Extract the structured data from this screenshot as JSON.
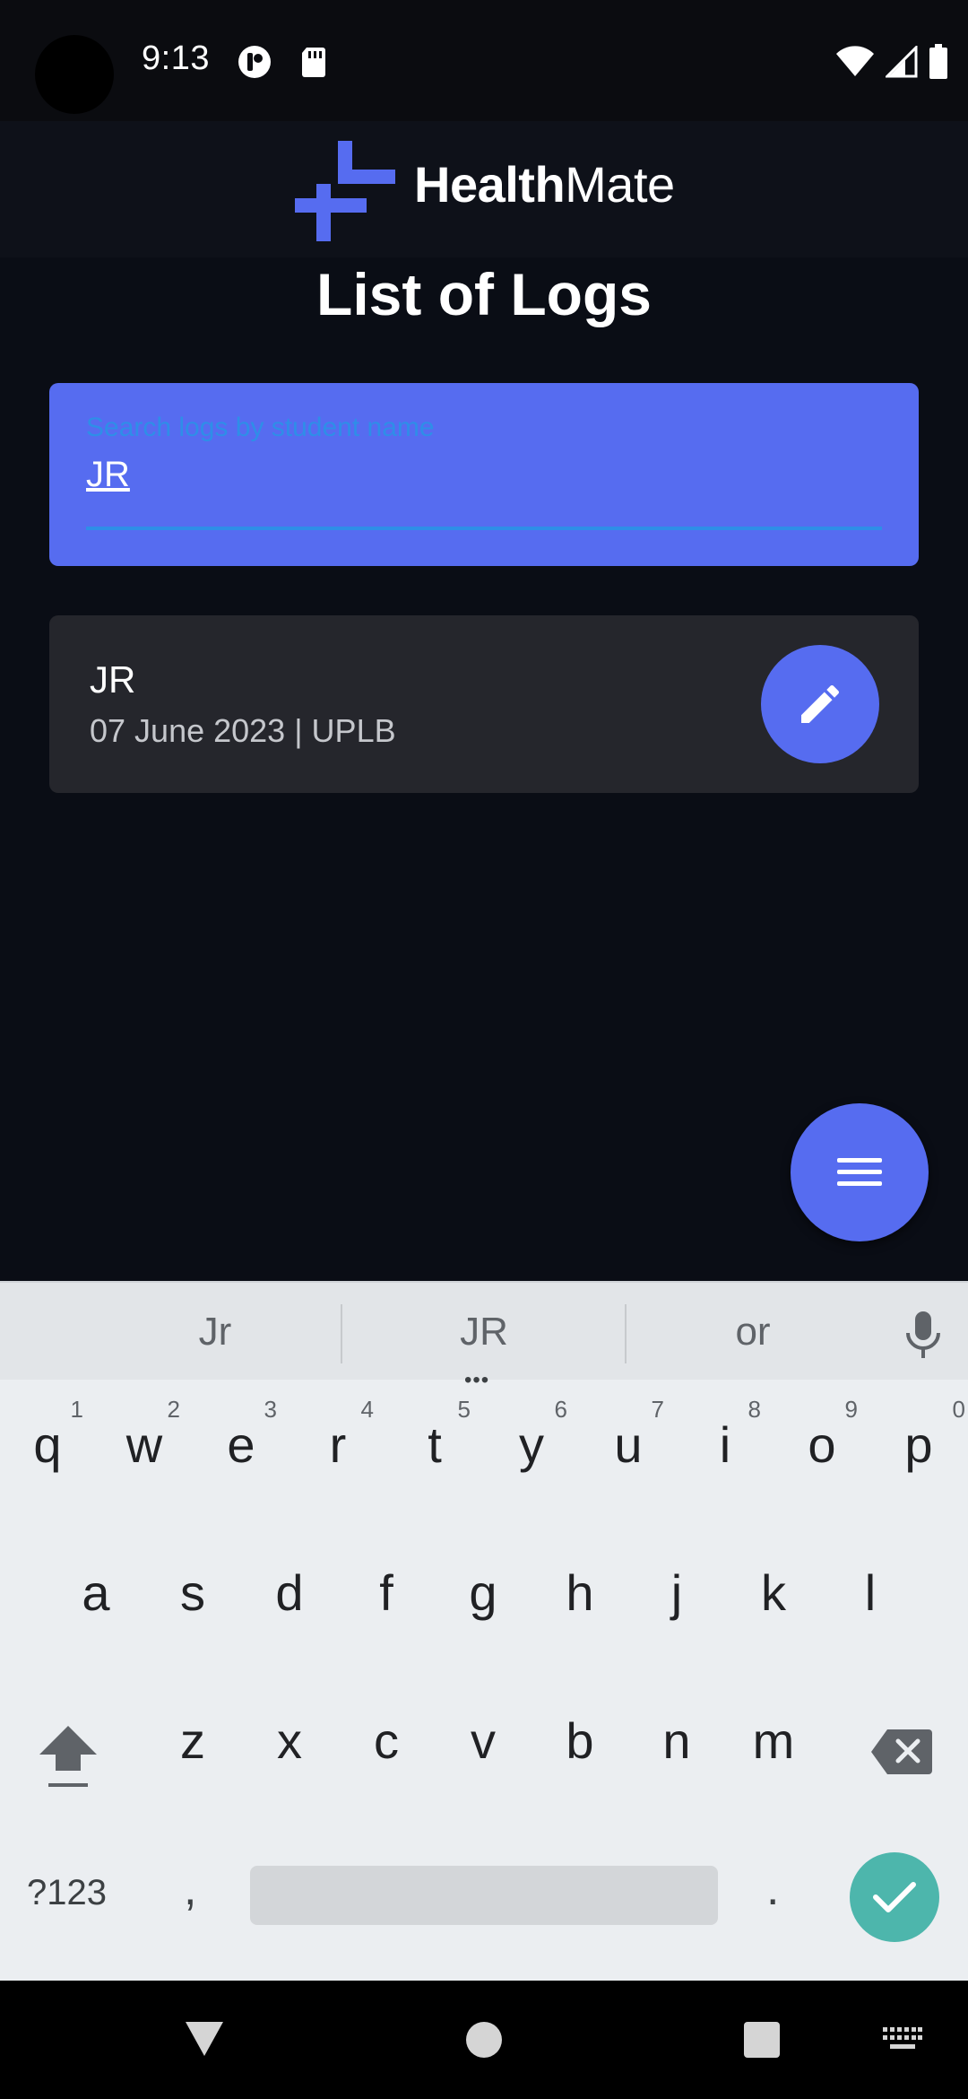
{
  "status_bar": {
    "time": "9:13",
    "left_icons": [
      "app-notification-icon",
      "sd-card-icon"
    ],
    "right_icons": [
      "wifi-icon",
      "signal-icon",
      "battery-icon"
    ]
  },
  "app_bar": {
    "logo_bold": "Health",
    "logo_regular": "Mate",
    "brand_color": "#566cf0"
  },
  "main": {
    "title": "List of Logs",
    "search": {
      "label": "Search logs by student name",
      "value": "JR"
    },
    "logs": [
      {
        "name": "JR",
        "meta": "07 June 2023 | UPLB",
        "action_icon": "pencil-icon"
      }
    ],
    "fab_icon": "menu-icon"
  },
  "keyboard": {
    "suggestions": [
      "Jr",
      "JR",
      "or"
    ],
    "more_suggestions": "•••",
    "row1": [
      {
        "k": "q",
        "h": "1"
      },
      {
        "k": "w",
        "h": "2"
      },
      {
        "k": "e",
        "h": "3"
      },
      {
        "k": "r",
        "h": "4"
      },
      {
        "k": "t",
        "h": "5"
      },
      {
        "k": "y",
        "h": "6"
      },
      {
        "k": "u",
        "h": "7"
      },
      {
        "k": "i",
        "h": "8"
      },
      {
        "k": "o",
        "h": "9"
      },
      {
        "k": "p",
        "h": "0"
      }
    ],
    "row2": [
      "a",
      "s",
      "d",
      "f",
      "g",
      "h",
      "j",
      "k",
      "l"
    ],
    "row3": [
      "z",
      "x",
      "c",
      "v",
      "b",
      "n",
      "m"
    ],
    "symbols_label": "?123",
    "comma": ",",
    "period": ".",
    "accent_color": "#4db6ac"
  },
  "nav_bar": {
    "icons": [
      "back-icon",
      "home-icon",
      "recents-icon",
      "keyboard-switch-icon"
    ]
  }
}
